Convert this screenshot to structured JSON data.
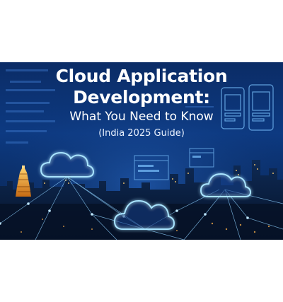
{
  "banner": {
    "title_line_1": "Cloud Application",
    "title_line_2": "Development:",
    "subtitle": "What You Need to Know",
    "tagline": "(India 2025 Guide)"
  },
  "colors": {
    "background": "#0b2c66",
    "glow": "#7fd2ff",
    "text": "#ffffff"
  },
  "icons": [
    "cloud-icon",
    "phone-mockup-icon",
    "browser-window-icon",
    "temple-tower"
  ]
}
